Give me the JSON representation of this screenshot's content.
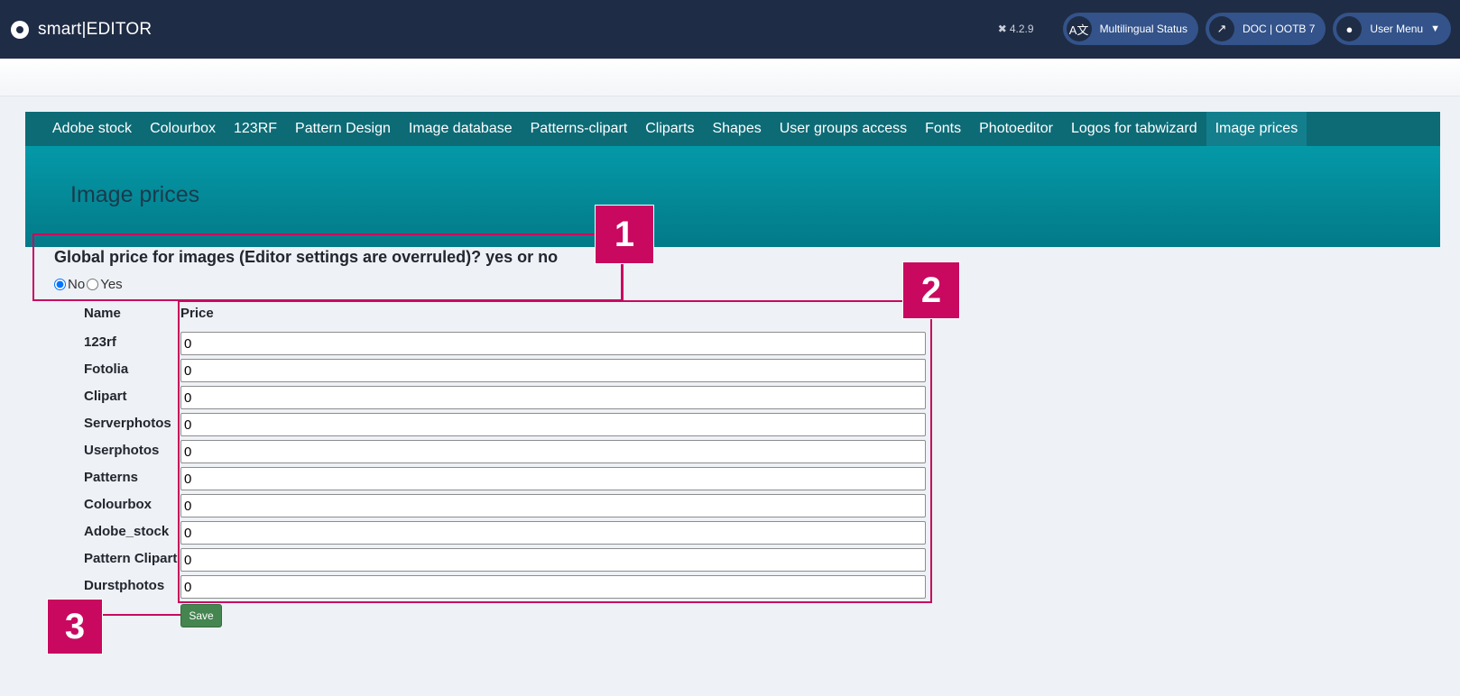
{
  "header": {
    "app_name": "smart|EDITOR",
    "version": "4.2.9",
    "buttons": [
      {
        "label": "Multilingual Status",
        "icon": "translate-icon"
      },
      {
        "label": "DOC | OOTB 7",
        "icon": "external-link-icon"
      },
      {
        "label": "User Menu",
        "icon": "user-circle-icon"
      }
    ]
  },
  "tabs": [
    {
      "label": "Adobe stock"
    },
    {
      "label": "Colourbox"
    },
    {
      "label": "123RF"
    },
    {
      "label": "Pattern Design"
    },
    {
      "label": "Image database"
    },
    {
      "label": "Patterns-clipart"
    },
    {
      "label": "Cliparts"
    },
    {
      "label": "Shapes"
    },
    {
      "label": "User groups access"
    },
    {
      "label": "Fonts"
    },
    {
      "label": "Photoeditor"
    },
    {
      "label": "Logos for tabwizard"
    },
    {
      "label": "Image prices"
    }
  ],
  "active_tab": "Image prices",
  "page_title": "Image prices",
  "form": {
    "question": "Global price for images (Editor settings are overruled)? yes or no",
    "options": {
      "no": "No",
      "yes": "Yes"
    },
    "selected": "No",
    "col_name": "Name",
    "col_price": "Price",
    "rows": [
      {
        "name": "123rf",
        "price": "0"
      },
      {
        "name": "Fotolia",
        "price": "0"
      },
      {
        "name": "Clipart",
        "price": "0"
      },
      {
        "name": "Serverphotos",
        "price": "0"
      },
      {
        "name": "Userphotos",
        "price": "0"
      },
      {
        "name": "Patterns",
        "price": "0"
      },
      {
        "name": "Colourbox",
        "price": "0"
      },
      {
        "name": "Adobe_stock",
        "price": "0"
      },
      {
        "name": "Pattern Clipart",
        "price": "0"
      },
      {
        "name": "Durstphotos",
        "price": "0"
      }
    ],
    "save_label": "Save"
  },
  "annotations": [
    "1",
    "2",
    "3"
  ],
  "colors": {
    "header_bg": "#1f2c45",
    "tab_bg": "#0d6b76",
    "banner": "#0499a8",
    "annotation": "#c8095f",
    "save_btn": "#458550"
  }
}
